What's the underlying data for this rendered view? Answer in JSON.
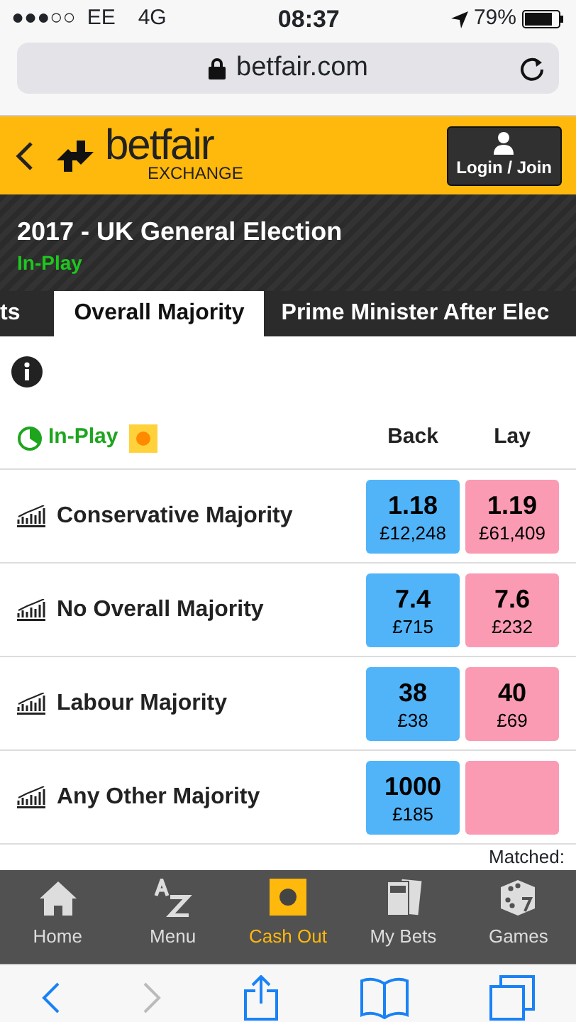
{
  "status_bar": {
    "signal": "●●●○○",
    "carrier": "EE",
    "network": "4G",
    "time": "08:37",
    "battery": "79%"
  },
  "address_bar": {
    "url": "betfair.com"
  },
  "header": {
    "logo_text": "betfair",
    "logo_sub": "EXCHANGE",
    "login": "Login / Join"
  },
  "event": {
    "title": "2017 - UK General Election",
    "status": "In-Play"
  },
  "tabs": [
    {
      "label": "ts",
      "selected": false
    },
    {
      "label": "Overall Majority",
      "selected": true
    },
    {
      "label": "Prime Minister After Elec",
      "selected": false
    }
  ],
  "market": {
    "inplay": "In-Play",
    "back_label": "Back",
    "lay_label": "Lay"
  },
  "runners": [
    {
      "name": "Conservative Majority",
      "back": {
        "price": "1.18",
        "size": "£12,248"
      },
      "lay": {
        "price": "1.19",
        "size": "£61,409"
      }
    },
    {
      "name": "No Overall Majority",
      "back": {
        "price": "7.4",
        "size": "£715"
      },
      "lay": {
        "price": "7.6",
        "size": "£232"
      }
    },
    {
      "name": "Labour Majority",
      "back": {
        "price": "38",
        "size": "£38"
      },
      "lay": {
        "price": "40",
        "size": "£69"
      }
    },
    {
      "name": "Any Other Majority",
      "back": {
        "price": "1000",
        "size": "£185"
      }
    }
  ],
  "matched": "Matched:",
  "bottom_nav": [
    {
      "label": "Home",
      "kind": "home",
      "selected": false
    },
    {
      "label": "Menu",
      "kind": "az",
      "selected": false
    },
    {
      "label": "Cash Out",
      "kind": "cashout",
      "selected": true
    },
    {
      "label": "My Bets",
      "kind": "bets",
      "selected": false
    },
    {
      "label": "Games",
      "kind": "dice",
      "selected": false
    }
  ]
}
